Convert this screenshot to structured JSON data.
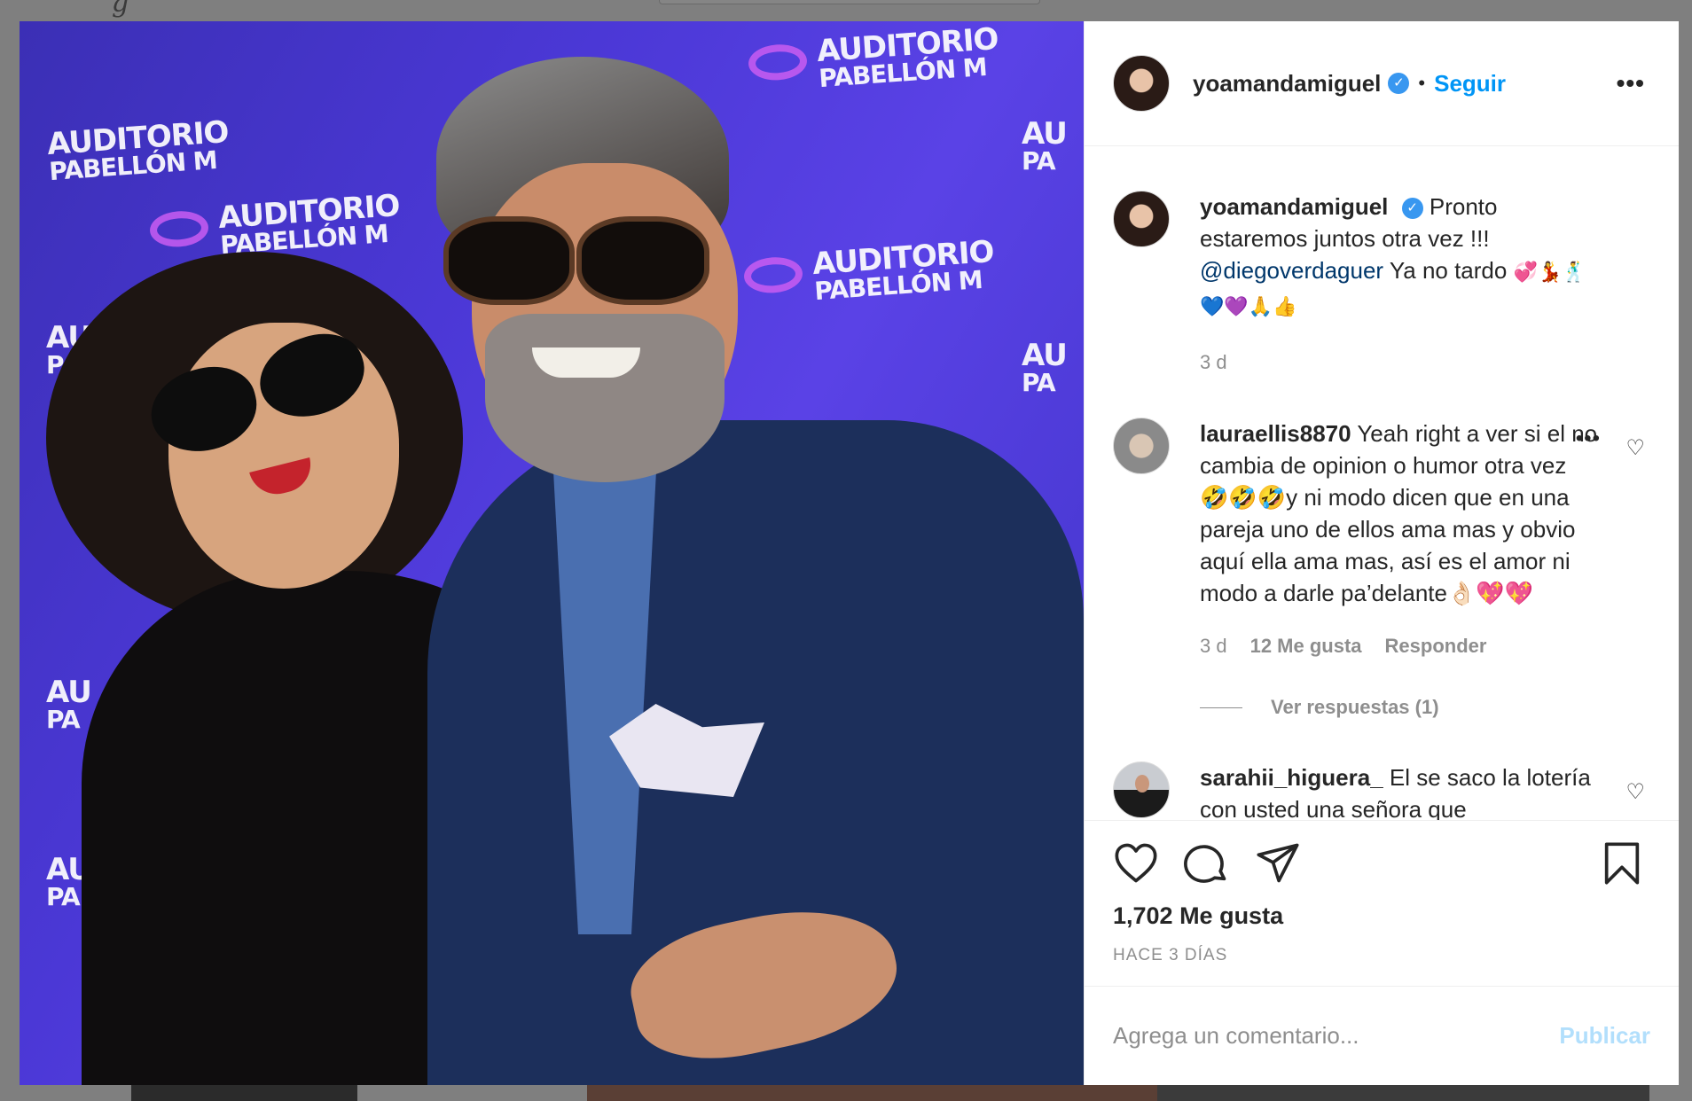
{
  "background": {
    "logo_fragment": "g"
  },
  "backdrop_logos": {
    "line1": "AUDITORIO",
    "line2": "PABELLÓN M"
  },
  "post": {
    "username": "yoamandamiguel",
    "verified_icon": "verified-badge-icon",
    "separator": "•",
    "follow_label": "Seguir",
    "more_icon": "•••",
    "caption": {
      "username": "yoamandamiguel",
      "text_before": "Pronto estaremos juntos otra vez !!! ",
      "mention": "@diegoverdaguer",
      "text_after": " Ya no tardo ",
      "emojis": "💞💃🕺💙💜🙏👍",
      "age": "3 d"
    }
  },
  "comments": [
    {
      "username": "lauraellis8870",
      "text": "Yeah right a ver si el no cambia de opinion o humor otra vez 🤣🤣🤣y ni modo dicen que en una pareja uno de ellos ama mas y obvio aquí ella ama mas, así es el amor ni modo a darle pa’delante👌🏻💖💖",
      "age": "3 d",
      "likes": "12 Me gusta",
      "reply_label": "Responder",
      "more_icon": "•••",
      "view_replies": "Ver respuestas (1)"
    },
    {
      "username": "sarahii_higuera_",
      "text": "El se saco la lotería con usted una señora que"
    }
  ],
  "actions": {
    "like_icon": "heart-icon",
    "comment_icon": "comment-bubble-icon",
    "share_icon": "paper-plane-icon",
    "save_icon": "bookmark-icon",
    "likes_count": "1,702 Me gusta",
    "post_age": "HACE 3 DÍAS"
  },
  "comment_box": {
    "placeholder": "Agrega un comentario...",
    "publish_label": "Publicar"
  },
  "colors": {
    "accent": "#0095f6",
    "verified": "#3897f0",
    "publish_disabled": "#b2dffc",
    "muted_text": "#8e8e8e",
    "overlay": "#7f7f7f"
  }
}
